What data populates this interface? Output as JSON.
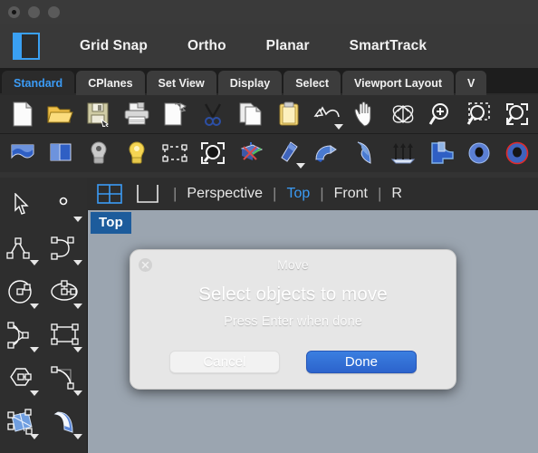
{
  "window": {
    "controls": [
      "close",
      "minimize",
      "zoom"
    ]
  },
  "header": {
    "logo_icon": "rhino-logo-icon",
    "items": [
      {
        "label": "Grid Snap",
        "name": "grid-snap"
      },
      {
        "label": "Ortho",
        "name": "ortho"
      },
      {
        "label": "Planar",
        "name": "planar"
      },
      {
        "label": "SmartTrack",
        "name": "smarttrack"
      }
    ]
  },
  "tabs": {
    "active": "Standard",
    "items": [
      {
        "label": "Standard"
      },
      {
        "label": "CPlanes"
      },
      {
        "label": "Set View"
      },
      {
        "label": "Display"
      },
      {
        "label": "Select"
      },
      {
        "label": "Viewport Layout"
      },
      {
        "label": "V"
      }
    ]
  },
  "toolbar_row1": [
    {
      "icon": "new-file-icon"
    },
    {
      "icon": "open-folder-icon"
    },
    {
      "icon": "save-icon"
    },
    {
      "icon": "print-icon"
    },
    {
      "icon": "cut-page-icon"
    },
    {
      "icon": "scissors-icon"
    },
    {
      "icon": "copy-icon"
    },
    {
      "icon": "paste-icon"
    },
    {
      "icon": "undo-icon"
    },
    {
      "icon": "pan-hand-icon"
    },
    {
      "icon": "rotate-view-icon"
    },
    {
      "icon": "zoom-in-icon"
    },
    {
      "icon": "zoom-window-icon"
    },
    {
      "icon": "zoom-extents-icon"
    }
  ],
  "toolbar_row2": [
    {
      "icon": "surface-loft-icon"
    },
    {
      "icon": "surface-extrude-icon"
    },
    {
      "icon": "light-off-icon"
    },
    {
      "icon": "light-on-icon"
    },
    {
      "icon": "select-points-icon"
    },
    {
      "icon": "select-zoom-icon"
    },
    {
      "icon": "gumball-icon"
    },
    {
      "icon": "bolt-icon"
    },
    {
      "icon": "pipe-bend-icon"
    },
    {
      "icon": "sweep-icon"
    },
    {
      "icon": "extrude-up-icon"
    },
    {
      "icon": "boolean-icon"
    },
    {
      "icon": "torus-icon"
    },
    {
      "icon": "circle-red-icon"
    }
  ],
  "viewport_tabs": {
    "layout_icon": "four-view-layout-icon",
    "single_icon": "single-view-layout-icon",
    "active": "Top",
    "items": [
      {
        "label": "Perspective"
      },
      {
        "label": "Top"
      },
      {
        "label": "Front"
      },
      {
        "label": "R"
      }
    ]
  },
  "palette": {
    "items": [
      {
        "icon": "select-arrow-icon",
        "has_flyout": false
      },
      {
        "icon": "point-icon",
        "has_flyout": true
      },
      {
        "icon": "polyline-icon",
        "has_flyout": true
      },
      {
        "icon": "curve-arc-icon",
        "has_flyout": true
      },
      {
        "icon": "circle-icon",
        "has_flyout": true
      },
      {
        "icon": "ellipse-icon",
        "has_flyout": true
      },
      {
        "icon": "arc-triangle-icon",
        "has_flyout": true
      },
      {
        "icon": "rectangle-icon",
        "has_flyout": true
      },
      {
        "icon": "polygon-icon",
        "has_flyout": true
      },
      {
        "icon": "fillet-curve-icon",
        "has_flyout": true
      },
      {
        "icon": "surface-from-points-icon",
        "has_flyout": true
      },
      {
        "icon": "surface-sweep-icon",
        "has_flyout": true
      }
    ]
  },
  "viewport": {
    "label": "Top",
    "background_color": "#9ba5b0",
    "label_color": "#1d5c9c"
  },
  "dialog": {
    "title": "Move",
    "prompt": "Select objects to move",
    "hint": "Press Enter when done",
    "close_icon": "close-icon",
    "cancel_label": "Cancel",
    "done_label": "Done",
    "done_color": "#2f6fd8"
  },
  "colors": {
    "accent": "#3b9bf5",
    "chrome": "#2d2d2d",
    "tab_active_bg": "#2b2b2b"
  }
}
